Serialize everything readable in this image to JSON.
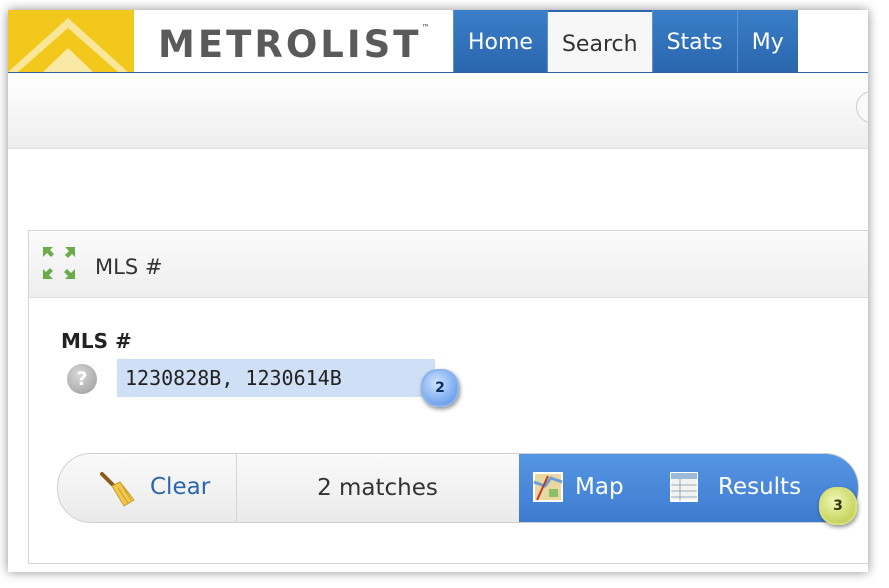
{
  "header": {
    "logo_text": "METROLIST",
    "logo_tm": "™",
    "tabs": [
      {
        "label": "Home",
        "active": false
      },
      {
        "label": "Search",
        "active": true
      },
      {
        "label": "Stats",
        "active": false
      },
      {
        "label": "My",
        "active": false
      }
    ]
  },
  "panel": {
    "title": "MLS #",
    "field_label": "MLS #",
    "mls_value": "1230828B, 1230614B",
    "help_glyph": "?"
  },
  "callouts": {
    "input": "2",
    "results": "3"
  },
  "actions": {
    "clear_label": "Clear",
    "matches_text": "2 matches",
    "map_label": "Map",
    "results_label": "Results"
  },
  "colors": {
    "brand_yellow": "#f2c81c",
    "tab_blue": "#2a66ad",
    "button_blue": "#4a88da",
    "input_highlight": "#cfdff5"
  }
}
